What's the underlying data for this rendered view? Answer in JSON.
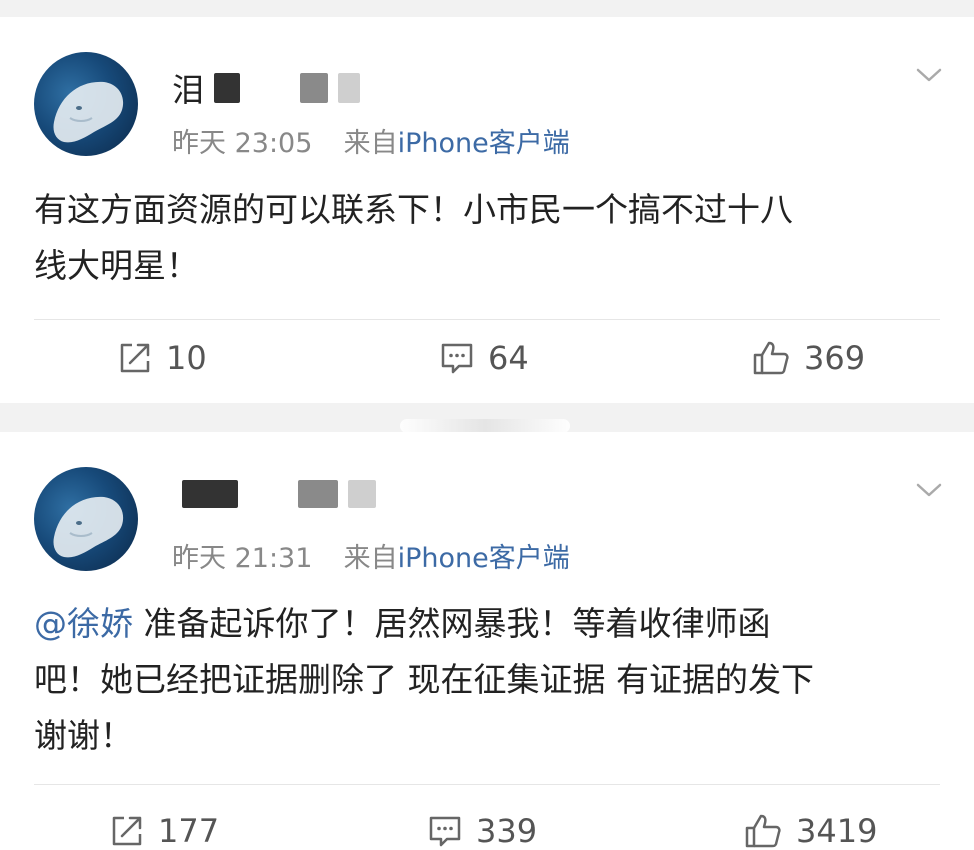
{
  "posts": [
    {
      "username": "泪",
      "time": "昨天 23:05",
      "source_prefix": "来自",
      "source": "iPhone客户端",
      "content_lines": [
        "有这方面资源的可以联系下！小市民一个搞不过十八",
        "线大明星！"
      ],
      "repost_count": "10",
      "comment_count": "64",
      "like_count": "369"
    },
    {
      "username": "",
      "time": "昨天 21:31",
      "source_prefix": "来自",
      "source": "iPhone客户端",
      "mention": "@徐娇",
      "content_first": " 准备起诉你了！居然网暴我！等着收律师函",
      "content_lines": [
        "吧！她已经把证据删除了 现在征集证据 有证据的发下",
        "谢谢！"
      ],
      "repost_count": "177",
      "comment_count": "339",
      "like_count": "3419"
    }
  ],
  "icons": {
    "repost": "repost-icon",
    "comment": "comment-icon",
    "like": "thumbs-up-icon",
    "menu": "chevron-down-icon"
  },
  "colors": {
    "link": "#3c6aa5",
    "meta": "#888888",
    "background": "#f2f2f2"
  }
}
